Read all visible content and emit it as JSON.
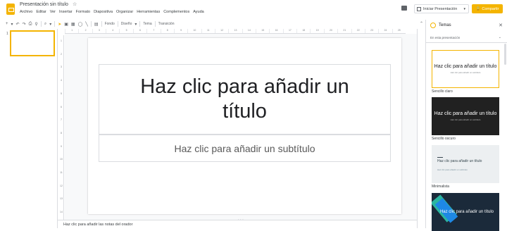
{
  "app": {
    "title": "Presentación sin título",
    "star_icon": "star-icon",
    "accent": "#f4b400"
  },
  "menu": [
    "Archivo",
    "Editar",
    "Ver",
    "Insertar",
    "Formato",
    "Diapositiva",
    "Organizar",
    "Herramientas",
    "Complementos",
    "Ayuda"
  ],
  "header": {
    "present_label": "Iniciar Presentación",
    "share_label": "Compartir"
  },
  "toolbar": {
    "background_label": "Fondo",
    "layout_label": "Diseño",
    "theme_label": "Tema",
    "transition_label": "Transición"
  },
  "filmstrip": {
    "slide_number": "1"
  },
  "ruler_top": [
    "1",
    "2",
    "3",
    "4",
    "5",
    "6",
    "7",
    "8",
    "9",
    "10",
    "11",
    "12",
    "13",
    "14",
    "15",
    "16",
    "17",
    "18",
    "19",
    "20",
    "21",
    "22",
    "23",
    "24",
    "25"
  ],
  "ruler_left": [
    "1",
    "2",
    "3",
    "4",
    "5",
    "6",
    "7",
    "8",
    "9",
    "10",
    "11",
    "12",
    "13",
    "14"
  ],
  "slide": {
    "title_placeholder": "Haz clic para añadir un título",
    "subtitle_placeholder": "Haz clic para añadir un subtítulo"
  },
  "notes": {
    "placeholder": "Haz clic para añadir las notas del orador"
  },
  "themes_panel": {
    "title": "Temas",
    "section": "En esta presentación",
    "themes": [
      {
        "name": "",
        "title": "Haz clic para añadir un título",
        "subtitle": "Haz clic para añadir un subtítulo"
      },
      {
        "name": "Sencillo claro",
        "title": "Haz clic para añadir un título",
        "subtitle": "Haz clic para añadir un subtítulo"
      },
      {
        "name": "Sencillo oscuro",
        "title": "Haz clic para añadir un título",
        "subtitle": "Haz clic para añadir un subtítulo"
      },
      {
        "name": "Minimalista",
        "title": "Haz clic para añadir un título",
        "subtitle": ""
      }
    ]
  }
}
